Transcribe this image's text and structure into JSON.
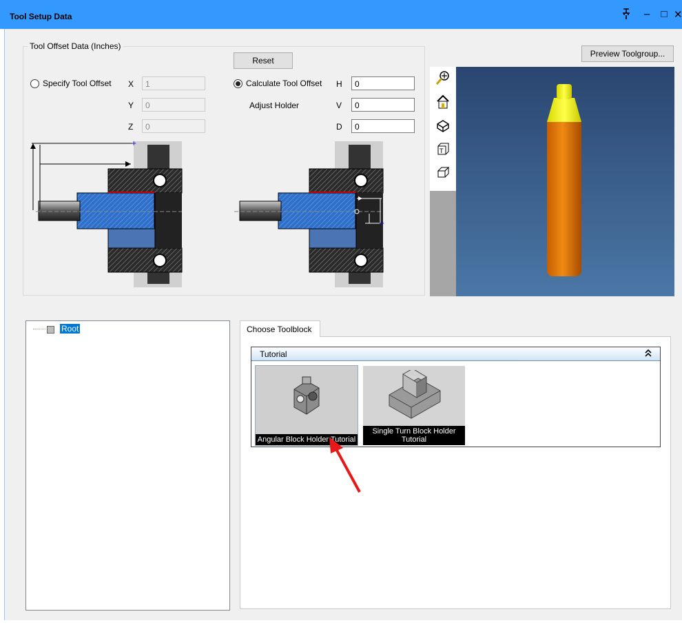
{
  "window": {
    "title": "Tool Setup Data",
    "pin_glyph": "祣",
    "minimize_glyph": "–",
    "maximize_glyph": "□",
    "close_glyph": "✕"
  },
  "offset_group": {
    "legend": "Tool Offset Data (Inches)",
    "reset_label": "Reset",
    "specify": {
      "label": "Specify Tool Offset",
      "selected": false,
      "x_label": "X",
      "x_value": "1",
      "y_label": "Y",
      "y_value": "0",
      "z_label": "Z",
      "z_value": "0"
    },
    "calculate": {
      "label": "Calculate Tool Offset",
      "selected": true,
      "adjust_label": "Adjust Holder",
      "h_label": "H",
      "h_value": "0",
      "v_label": "V",
      "v_value": "0",
      "d_label": "D",
      "d_value": "0"
    }
  },
  "preview": {
    "button_label": "Preview Toolgroup...",
    "toolbar_icons": [
      "zoom-icon",
      "home-view-icon",
      "iso-view-icon",
      "top-view-icon",
      "side-view-icon"
    ],
    "tool_colors": {
      "tip": "#f2f21a",
      "body": "#e07b08",
      "background": "#3a6090"
    }
  },
  "tree": {
    "root_label": "Root"
  },
  "toolblock": {
    "tab_label": "Choose Toolblock",
    "category": "Tutorial",
    "collapse_glyph": "⮭",
    "items": [
      {
        "label": "Angular Block Holder Tutorial"
      },
      {
        "label": "Single Turn Block Holder Tutorial"
      }
    ]
  }
}
